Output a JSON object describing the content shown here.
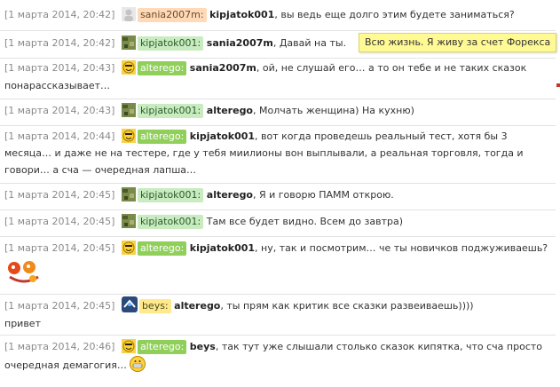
{
  "tooltip": "Всю жизнь. Я живу за счет Форекса",
  "messages": [
    {
      "time": "[1 марта 2014, 20:42]",
      "author": "sania2007m:",
      "to": "kipjatok001",
      "text": ", вы ведь еще долго этим будете заниматься?"
    },
    {
      "time": "[1 марта 2014, 20:42]",
      "author": "kipjatok001:",
      "to": "sania2007m",
      "text": ", Давай на ты."
    },
    {
      "time": "[1 марта 2014, 20:43]",
      "author": "alterego:",
      "to": "sania2007m",
      "text": ", ой, не слушай его… а то он тебе и не таких сказок",
      "text2": "понарассказывает…"
    },
    {
      "time": "[1 марта 2014, 20:43]",
      "author": "kipjatok001:",
      "to": "alterego",
      "text": ", Молчать женщина) На кухню)"
    },
    {
      "time": "[1 марта 2014, 20:44]",
      "author": "alterego:",
      "to": "kipjatok001",
      "text": ", вот когда проведешь реальный тест, хотя бы 3",
      "text2": "месяца… и даже не на тестере, где у тебя миилионы вон выплывали, а реальная торговля, тогда и",
      "text3": "говори… а сча — очередная лапша…"
    },
    {
      "time": "[1 марта 2014, 20:45]",
      "author": "kipjatok001:",
      "to": "alterego",
      "text": ", Я и говорю ПАММ открою."
    },
    {
      "time": "[1 марта 2014, 20:45]",
      "author": "kipjatok001:",
      "text": "Там все будет видно. Всем до завтра)"
    },
    {
      "time": "[1 марта 2014, 20:45]",
      "author": "alterego:",
      "to": "kipjatok001",
      "text": ", ну, так и посмотрим… че ты новичков поджуживаешь?"
    },
    {
      "time": "[1 марта 2014, 20:45]",
      "author": "beys:",
      "to": "alterego",
      "text": ", ты прям как критик все сказки развеиваешь))))",
      "text2": "привет"
    },
    {
      "time": "[1 марта 2014, 20:46]",
      "author": "alterego:",
      "to": "beys",
      "text": ", так тут уже слышали столько сказок кипятка, что сча просто",
      "text2": "очередная демагогия…"
    }
  ]
}
